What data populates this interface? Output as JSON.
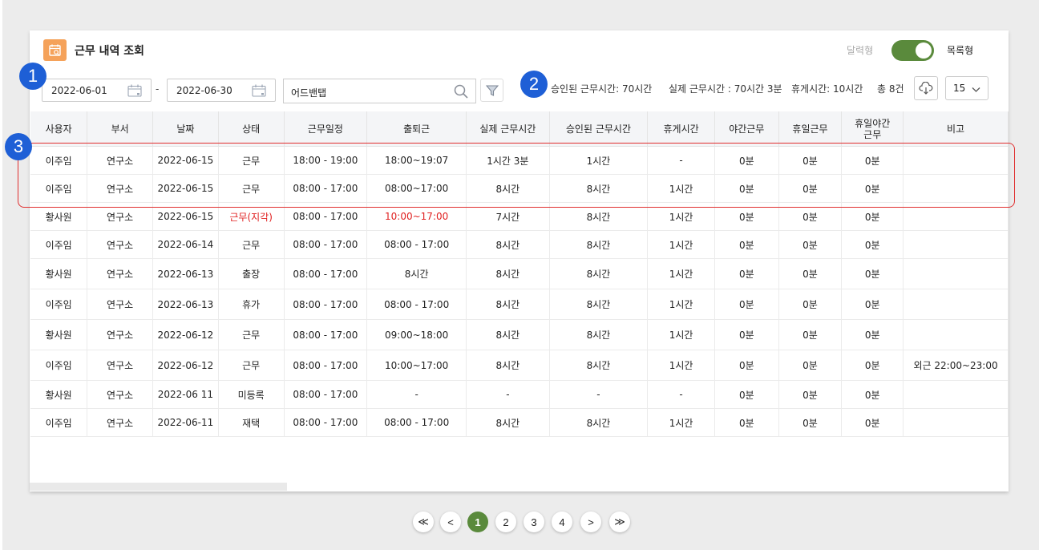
{
  "header": {
    "title": "근무 내역 조회",
    "toggle_left": "달력형",
    "toggle_right": "목록형",
    "toggle_color": "#5a8a3c"
  },
  "markers": [
    "1",
    "2",
    "3"
  ],
  "filters": {
    "start_date": "2022-06-01",
    "end_date": "2022-06-30",
    "separator": "-",
    "search_value": "어드밴탭"
  },
  "summary": {
    "approved": "승인된 근무시간: 70시간",
    "actual": "실제 근무시간 : 70시간 3분",
    "break": "휴게시간: 10시간",
    "total": "총 8건"
  },
  "page_size": "15",
  "table": {
    "headers": [
      "사용자",
      "부서",
      "날짜",
      "상태",
      "근무일정",
      "출퇴근",
      "실제 근무시간",
      "승인된 근무시간",
      "휴게시간",
      "야간근무",
      "휴일근무",
      "휴일야간\n근무",
      "비고"
    ],
    "rows": [
      [
        "이주임",
        "연구소",
        "2022-06-15",
        "근무",
        "18:00 - 19:00",
        "18:00~19:07",
        "1시간 3분",
        "1시간",
        "-",
        "0분",
        "0분",
        "0분",
        ""
      ],
      [
        "이주임",
        "연구소",
        "2022-06-15",
        "근무",
        "08:00 - 17:00",
        "08:00~17:00",
        "8시간",
        "8시간",
        "1시간",
        "0분",
        "0분",
        "0분",
        ""
      ],
      [
        "황사원",
        "연구소",
        "2022-06-15",
        "근무(지각)",
        "08:00 - 17:00",
        "10:00~17:00",
        "7시간",
        "8시간",
        "1시간",
        "0분",
        "0분",
        "0분",
        ""
      ],
      [
        "이주임",
        "연구소",
        "2022-06-14",
        "근무",
        "08:00 - 17:00",
        "08:00 - 17:00",
        "8시간",
        "8시간",
        "1시간",
        "0분",
        "0분",
        "0분",
        ""
      ],
      [
        "황사원",
        "연구소",
        "2022-06-13",
        "출장",
        "08:00 - 17:00",
        "8시간",
        "8시간",
        "8시간",
        "1시간",
        "0분",
        "0분",
        "0분",
        ""
      ],
      [
        "이주임",
        "연구소",
        "2022-06-13",
        "휴가",
        "08:00 - 17:00",
        "08:00 - 17:00",
        "8시간",
        "8시간",
        "1시간",
        "0분",
        "0분",
        "0분",
        ""
      ],
      [
        "황사원",
        "연구소",
        "2022-06-12",
        "근무",
        "08:00 - 17:00",
        "09:00~18:00",
        "8시간",
        "8시간",
        "1시간",
        "0분",
        "0분",
        "0분",
        ""
      ],
      [
        "이주임",
        "연구소",
        "2022-06-12",
        "근무",
        "08:00 - 17:00",
        "10:00~17:00",
        "8시간",
        "8시간",
        "1시간",
        "0분",
        "0분",
        "0분",
        "외근 22:00~23:00"
      ],
      [
        "황사원",
        "연구소",
        "2022-06 11",
        "미등록",
        "08:00 - 17:00",
        "-",
        "-",
        "-",
        "-",
        "0분",
        "0분",
        "0분",
        ""
      ],
      [
        "이주임",
        "연구소",
        "2022-06-11",
        "재택",
        "08:00 - 17:00",
        "08:00 - 17:00",
        "8시간",
        "8시간",
        "1시간",
        "0분",
        "0분",
        "0분",
        ""
      ]
    ],
    "late_color": "#e02020"
  },
  "pagination": {
    "first": "≪",
    "prev": "<",
    "pages": [
      "1",
      "2",
      "3",
      "4"
    ],
    "next": ">",
    "last": "≫",
    "active": "1"
  }
}
